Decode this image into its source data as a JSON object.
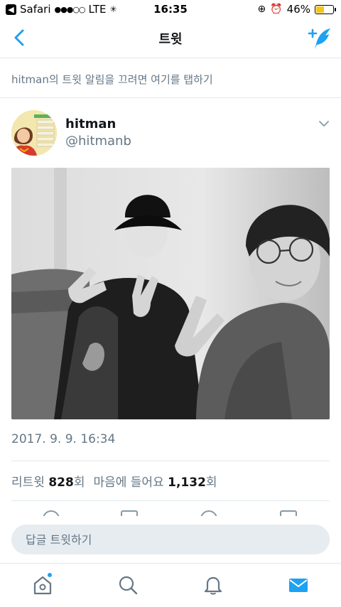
{
  "status_bar": {
    "carrier": "Safari",
    "signal": "●●●○○",
    "network": "LTE",
    "time": "16:35",
    "battery_percent": "46%",
    "battery_level": 0.46
  },
  "nav": {
    "title": "트윗"
  },
  "notify": {
    "text": "hitman의 트윗 알림을 끄려면 여기를 탭하기"
  },
  "tweet": {
    "author_name": "hitman",
    "author_handle": "@hitmanb",
    "timestamp": "2017. 9. 9. 16:34",
    "retweet_label": "리트윗",
    "retweet_count": "828",
    "retweet_unit": "회",
    "like_label": "마음에 들어요",
    "like_count": "1,132",
    "like_unit": "회"
  },
  "reply": {
    "placeholder": "답글 트윗하기"
  },
  "colors": {
    "accent": "#1da1f2",
    "muted": "#657786",
    "divider": "#e1e8ed",
    "battery": "#f5c518"
  },
  "icons": {
    "back": "chevron-left-icon",
    "compose": "compose-feather-icon",
    "more": "chevron-down-icon",
    "tabs": [
      "home-icon",
      "search-icon",
      "bell-icon",
      "mail-icon"
    ]
  }
}
